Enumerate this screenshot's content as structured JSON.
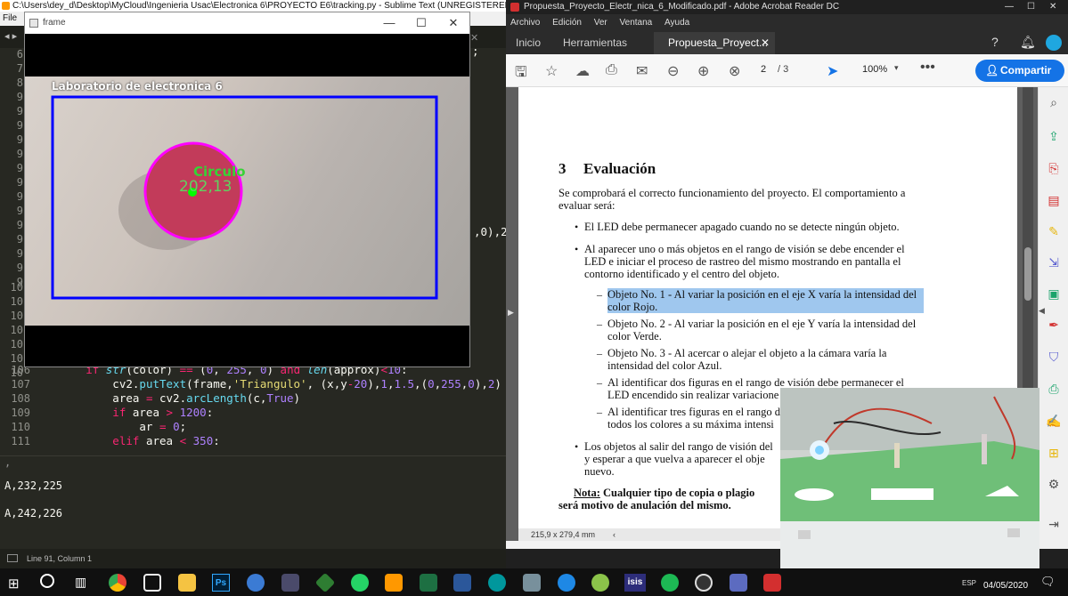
{
  "sublime": {
    "title": "C:\\Users\\dey_d\\Desktop\\MyCloud\\Ingenieria Usac\\Electronica 6\\PROYECTO E6\\tracking.py - Sublime Text (UNREGISTERED)",
    "menu_file": "File",
    "line_numbers": [
      "6",
      "7",
      "8",
      "9",
      "9",
      "9",
      "9",
      "9",
      "9",
      "9",
      "9",
      "9",
      "9",
      "9",
      "9",
      "9",
      "9",
      "10",
      "10",
      "10",
      "10",
      "10",
      "10",
      "10",
      "106",
      "107",
      "108",
      "109",
      "110",
      "111"
    ],
    "code_lines": {
      "l106": "        if str(color) == (0, 255, 0) and len(approx)<10:",
      "l107": "            cv2.putText(frame,'Triangulo', (x,y-20),1,1.5,(0,255,0),2)",
      "l108": "            area = cv2.arcLength(c,True)",
      "l109": "            if area > 1200:",
      "l110": "                ar = 0;",
      "l111": "            elif area < 350:"
    },
    "visible_fragment_top": ";",
    "visible_fragment_mid": ",0),2",
    "console": [
      "A,232,225",
      "A,242,226"
    ],
    "status": "Line 91, Column 1"
  },
  "frame_window": {
    "title": "frame",
    "overlay_label": "Laboratorio de electronica 6",
    "shape_label": "Circulo",
    "coords": "202,13"
  },
  "acrobat": {
    "title": "Propuesta_Proyecto_Electr_nica_6_Modificado.pdf - Adobe Acrobat Reader DC",
    "menu": [
      "Archivo",
      "Edición",
      "Ver",
      "Ventana",
      "Ayuda"
    ],
    "tabs": {
      "home": "Inicio",
      "tools": "Herramientas",
      "doc": "Propuesta_Proyect..."
    },
    "page_current": "2",
    "page_total": "/ 3",
    "zoom": "100%",
    "share": "Compartir",
    "page_size": "215,9 x 279,4 mm"
  },
  "document": {
    "section_number": "3",
    "section_title": "Evaluación",
    "intro": "Se comprobará el correcto funcionamiento del proyecto. El comportamiento a evaluar será:",
    "bullet1": "El LED debe permanecer apagado cuando no se detecte ningún objeto.",
    "bullet2": "Al aparecer uno o más objetos en el rango de visión se debe encender el LED e iniciar el proceso de rastreo del mismo mostrando en pantalla el contorno identificado y el centro del objeto.",
    "sub1": "Objeto No. 1 - Al variar la posición en el eje X varía la intensidad del color Rojo.",
    "sub2": "Objeto No. 2 - Al variar la posición en el eje Y varía la intensidad del color Verde.",
    "sub3": "Objeto No. 3 - Al acercar o alejar el objeto a la cámara varía la intensidad del color Azul.",
    "sub4a": "Al identificar dos figuras en el rango de visión debe permanecer el",
    "sub4b": "LED encendido sin realizar variacione",
    "sub5a": "Al identificar tres figuras en el rango d",
    "sub5b": "todos los colores a su máxima intensi",
    "bullet3a": "Los objetos al salir del rango de visión del",
    "bullet3b": "y esperar a que vuelva a aparecer el obje",
    "bullet3c": "nuevo.",
    "note_label": "Nota:",
    "note_a": " Cualquier tipo de copia o plagio",
    "note_b": "será motivo de anulación del mismo."
  },
  "taskbar": {
    "date": "04/05/2020",
    "lang": "ESP",
    "icons": [
      "windows-start",
      "search",
      "task-view",
      "chrome",
      "3d-viewer",
      "file-explorer",
      "photoshop",
      "firefox",
      "video-app",
      "git-app",
      "whatsapp",
      "sublime",
      "excel",
      "word",
      "arduino",
      "vmware",
      "edge",
      "app-green",
      "isis",
      "spotify",
      "obs",
      "paint",
      "acrobat"
    ],
    "isis_label": "isis",
    "ps_label": "Ps"
  },
  "colors": {
    "circle_outline": "#ff00ff",
    "rect_outline": "#0000ff",
    "label_green": "#00ff00",
    "highlight": "#9fc7ee",
    "share_blue": "#1473e6"
  }
}
